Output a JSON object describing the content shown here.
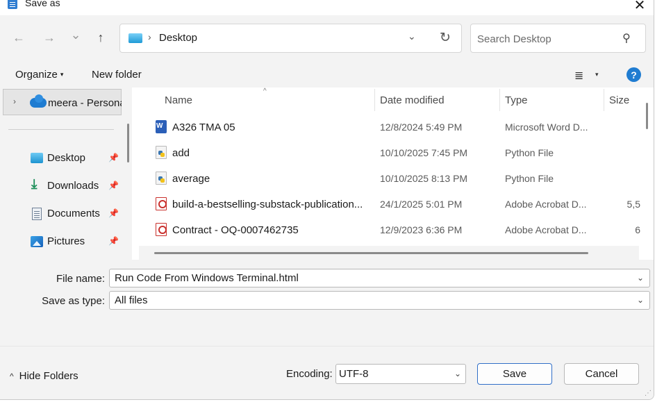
{
  "window": {
    "title": "Save as",
    "close_glyph": "✕"
  },
  "navigation": {
    "back_glyph": "←",
    "forward_glyph": "→",
    "recent_glyph": "⌄",
    "up_glyph": "↑",
    "address_separator": "›",
    "address_location": "Desktop",
    "address_dropdown_glyph": "⌄",
    "refresh_glyph": "↻",
    "search_placeholder": "Search Desktop",
    "search_glyph": "⚲"
  },
  "toolbar": {
    "organize_label": "Organize",
    "organize_caret": "▾",
    "new_folder_label": "New folder",
    "view_glyph": "≣",
    "view_dropdown_glyph": "▾",
    "help_glyph": "?"
  },
  "nav_pane": {
    "expand_glyph": "›",
    "cloud_label": "meera - Personal",
    "pin_glyph": "📌",
    "items": [
      {
        "label": "Desktop"
      },
      {
        "label": "Downloads"
      },
      {
        "label": "Documents"
      },
      {
        "label": "Pictures"
      }
    ]
  },
  "file_list": {
    "sort_glyph": "^",
    "columns": {
      "name": "Name",
      "date": "Date modified",
      "type": "Type",
      "size": "Size"
    },
    "rows": [
      {
        "name": "A326 TMA 05",
        "date": "12/8/2024 5:49 PM",
        "type": "Microsoft Word D...",
        "size": "",
        "icon": "word-document-icon"
      },
      {
        "name": "add",
        "date": "10/10/2025 7:45 PM",
        "type": "Python File",
        "size": "",
        "icon": "python-file-icon"
      },
      {
        "name": "average",
        "date": "10/10/2025 8:13 PM",
        "type": "Python File",
        "size": "",
        "icon": "python-file-icon"
      },
      {
        "name": "build-a-bestselling-substack-publication...",
        "date": "24/1/2025 5:01 PM",
        "type": "Adobe Acrobat D...",
        "size": "5,5",
        "icon": "pdf-file-icon"
      },
      {
        "name": "Contract - OQ-0007462735",
        "date": "12/9/2023 6:36 PM",
        "type": "Adobe Acrobat D...",
        "size": "6",
        "icon": "pdf-file-icon"
      }
    ]
  },
  "form": {
    "file_name_label": "File name:",
    "file_name_value": "Run Code From Windows Terminal.html",
    "save_type_label": "Save as type:",
    "save_type_value": "All files",
    "dropdown_glyph": "⌄"
  },
  "footer": {
    "hide_folders_caret": "^",
    "hide_folders_label": "Hide Folders",
    "encoding_label": "Encoding:",
    "encoding_value": "UTF-8",
    "encoding_dropdown_glyph": "⌄",
    "save_label": "Save",
    "cancel_label": "Cancel",
    "grip_glyph": "⋰"
  },
  "colors": {
    "accent": "#1f7cd1",
    "window_bg": "#f3f3f3",
    "list_bg": "#ffffff"
  }
}
